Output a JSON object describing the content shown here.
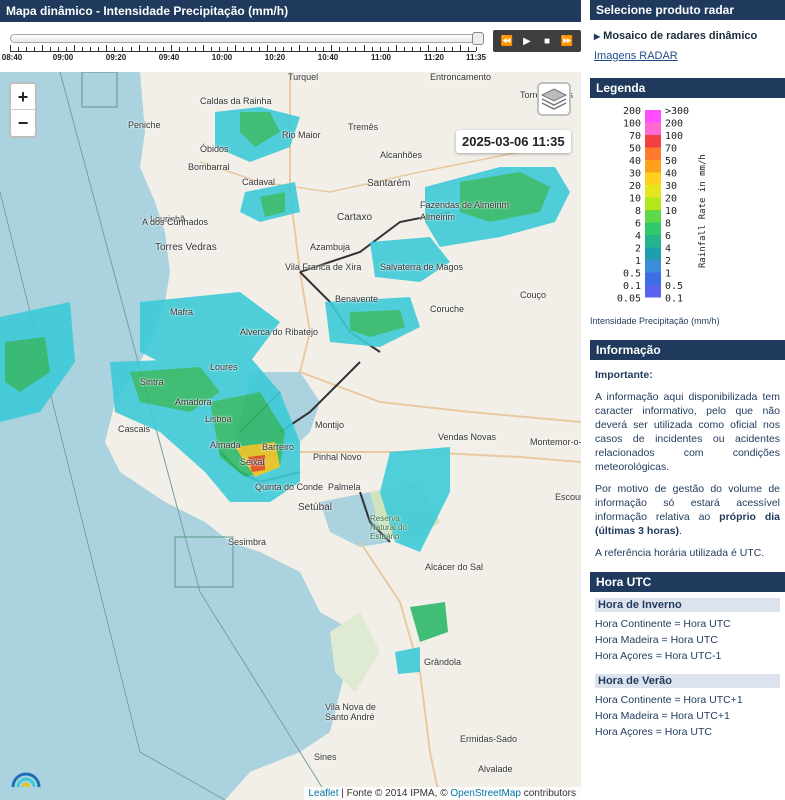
{
  "header": {
    "title": "Mapa dinâmico - Intensidade Precipitação (mm/h)"
  },
  "timeline": {
    "labels": [
      "08:40",
      "09:00",
      "09:20",
      "09:40",
      "10:00",
      "10:20",
      "10:40",
      "11:00",
      "11:20",
      "11:35"
    ],
    "current": "11:35",
    "progress": 1.0
  },
  "player": {
    "rewind": "⏪",
    "play": "▶",
    "stop": "■",
    "forward": "⏩"
  },
  "map": {
    "timestamp": "2025-03-06 11:35",
    "zoom_in": "+",
    "zoom_out": "−",
    "attribution": {
      "leaflet": "Leaflet",
      "source": " | Fonte © 2014 IPMA, © ",
      "osm": "OpenStreetMap",
      "contrib": " contributors"
    },
    "places": [
      "Caldas da Rainha",
      "Peniche",
      "Rio Maior",
      "Turquel",
      "Entroncamento",
      "Torres Novas",
      "Tremês",
      "Alcanhões",
      "Santarém",
      "Óbidos",
      "Bombarral",
      "Cadaval",
      "Lourinhã",
      "Torres Vedras",
      "A dos Cunhados",
      "Cartaxo",
      "Almeirim",
      "Azambuja",
      "Vila Franca de Xira",
      "Benavente",
      "Coruche",
      "Couço",
      "Alverca do Ribatejo",
      "Mafra",
      "Loures",
      "Sintra",
      "Amadora",
      "Cascais",
      "Lisboa",
      "Montijo",
      "Almada",
      "Seixal",
      "Barreiro",
      "Palmela",
      "Setúbal",
      "Sesimbra",
      "Pinhal Novo",
      "Vendas Novas",
      "Montemor-o-Novo",
      "Alcácer do Sal",
      "Grândola",
      "Sines",
      "Santo André",
      "Vila Nova de Santo André",
      "Ermidas-Sado",
      "Alvalade",
      "Escoural",
      "Salvaterra de Magos",
      "Reserva Natural do Estuário do Sado",
      "Quinta do Conde",
      "Fazendas de Almeirim"
    ]
  },
  "sidebar": {
    "product_title": "Selecione produto radar",
    "product_selected": "Mosaico de radares dinâmico",
    "product_link": "Imagens RADAR",
    "legend_title": "Legenda",
    "legend_left": [
      "200",
      "100",
      "70",
      "50",
      "40",
      "30",
      "20",
      "10",
      "8",
      "6",
      "4",
      "2",
      "1",
      "0.5",
      "0.1",
      "0.05"
    ],
    "legend_right": [
      ">300",
      "200",
      "100",
      "70",
      "50",
      "40",
      "30",
      "20",
      "10",
      "8",
      "6",
      "4",
      "2",
      "1",
      "0.5",
      "0.1"
    ],
    "legend_axis": "Rainfall Rate in mm/h",
    "legend_caption": "Intensidade Precipitação (mm/h)",
    "info_title": "Informação",
    "info_important": "Importante:",
    "info_p1": "A informação aqui disponibilizada tem caracter informativo, pelo que não deverá ser utilizada como oficial nos casos de incidentes ou acidentes relacionados com condições meteorológicas.",
    "info_p2a": "Por motivo de gestão do volume de informação só estará acessível informação relativa ao ",
    "info_p2b": "próprio dia (últimas 3 horas)",
    "info_p2c": ".",
    "info_p3": "A referência horária utilizada é UTC.",
    "hora_title": "Hora UTC",
    "winter_title": "Hora de Inverno",
    "winter": [
      "Hora Continente = Hora UTC",
      "Hora Madeira = Hora UTC",
      "Hora Açores = Hora UTC-1"
    ],
    "summer_title": "Hora de Verão",
    "summer": [
      "Hora Continente = Hora UTC+1",
      "Hora Madeira = Hora UTC+1",
      "Hora Açores = Hora UTC"
    ]
  },
  "colors": {
    "header_bg": "#1f3a5c",
    "sea": "#aad3df",
    "land": "#f2efe9",
    "rain_light": "#3ecbd8",
    "rain_medium": "#2fb86a",
    "rain_heavy": "#e8c21e",
    "rain_intense": "#e24a1e"
  }
}
